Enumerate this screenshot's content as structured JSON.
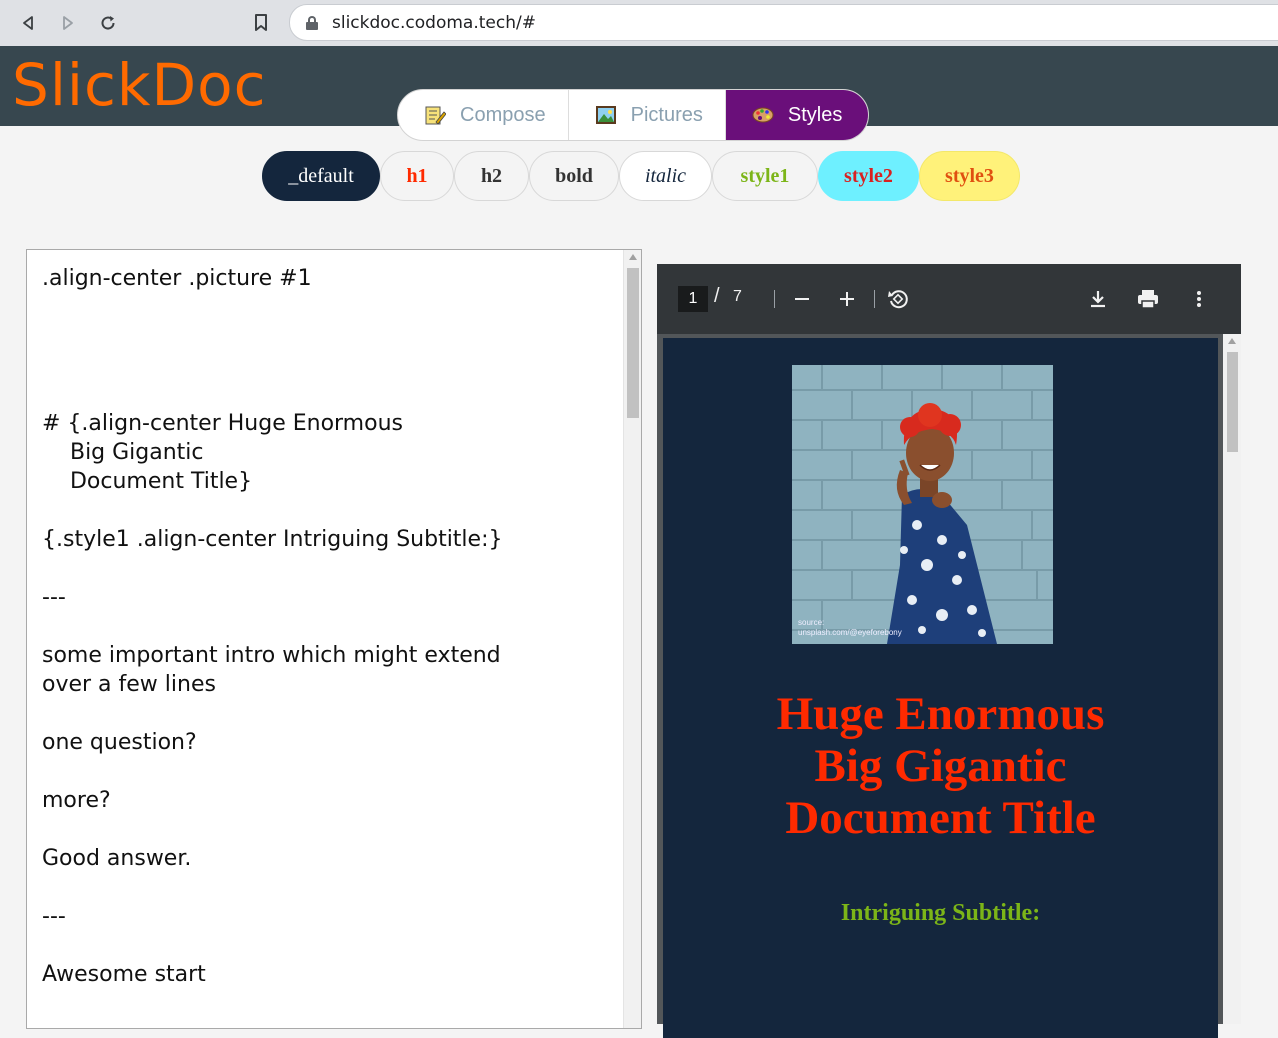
{
  "browser": {
    "url": "slickdoc.codoma.tech/#"
  },
  "app": {
    "logo": "SlickDoc"
  },
  "main_tabs": [
    {
      "label": "Compose",
      "active": false
    },
    {
      "label": "Pictures",
      "active": false
    },
    {
      "label": "Styles",
      "active": true
    }
  ],
  "style_chips": [
    {
      "label": "_default"
    },
    {
      "label": "h1"
    },
    {
      "label": "h2"
    },
    {
      "label": "bold"
    },
    {
      "label": "italic"
    },
    {
      "label": "style1"
    },
    {
      "label": "style2"
    },
    {
      "label": "style3"
    }
  ],
  "editor": {
    "content": ".align-center .picture #1\n\n\n\n\n# {.align-center Huge Enormous\n    Big Gigantic\n    Document Title}\n\n{.style1 .align-center Intriguing Subtitle:}\n\n---\n\nsome important intro which might extend\nover a few lines\n\none question?\n\nmore?\n\nGood answer.\n\n---\n\nAwesome start"
  },
  "pdf": {
    "current_page": "1",
    "page_separator": "/",
    "total_pages": "7",
    "photo_caption_line1": "source:",
    "photo_caption_line2": "unsplash.com/@eyeforebony",
    "title_line1": "Huge Enormous",
    "title_line2": "Big Gigantic",
    "title_line3": "Document Title",
    "subtitle": "Intriguing Subtitle:"
  },
  "colors": {
    "header_bg": "#37474f",
    "logo": "#ff6a00",
    "active_tab": "#6a0f7a",
    "pdf_page_bg": "#14263d",
    "doc_title": "#ff2a00",
    "doc_subtitle": "#7cb518"
  }
}
